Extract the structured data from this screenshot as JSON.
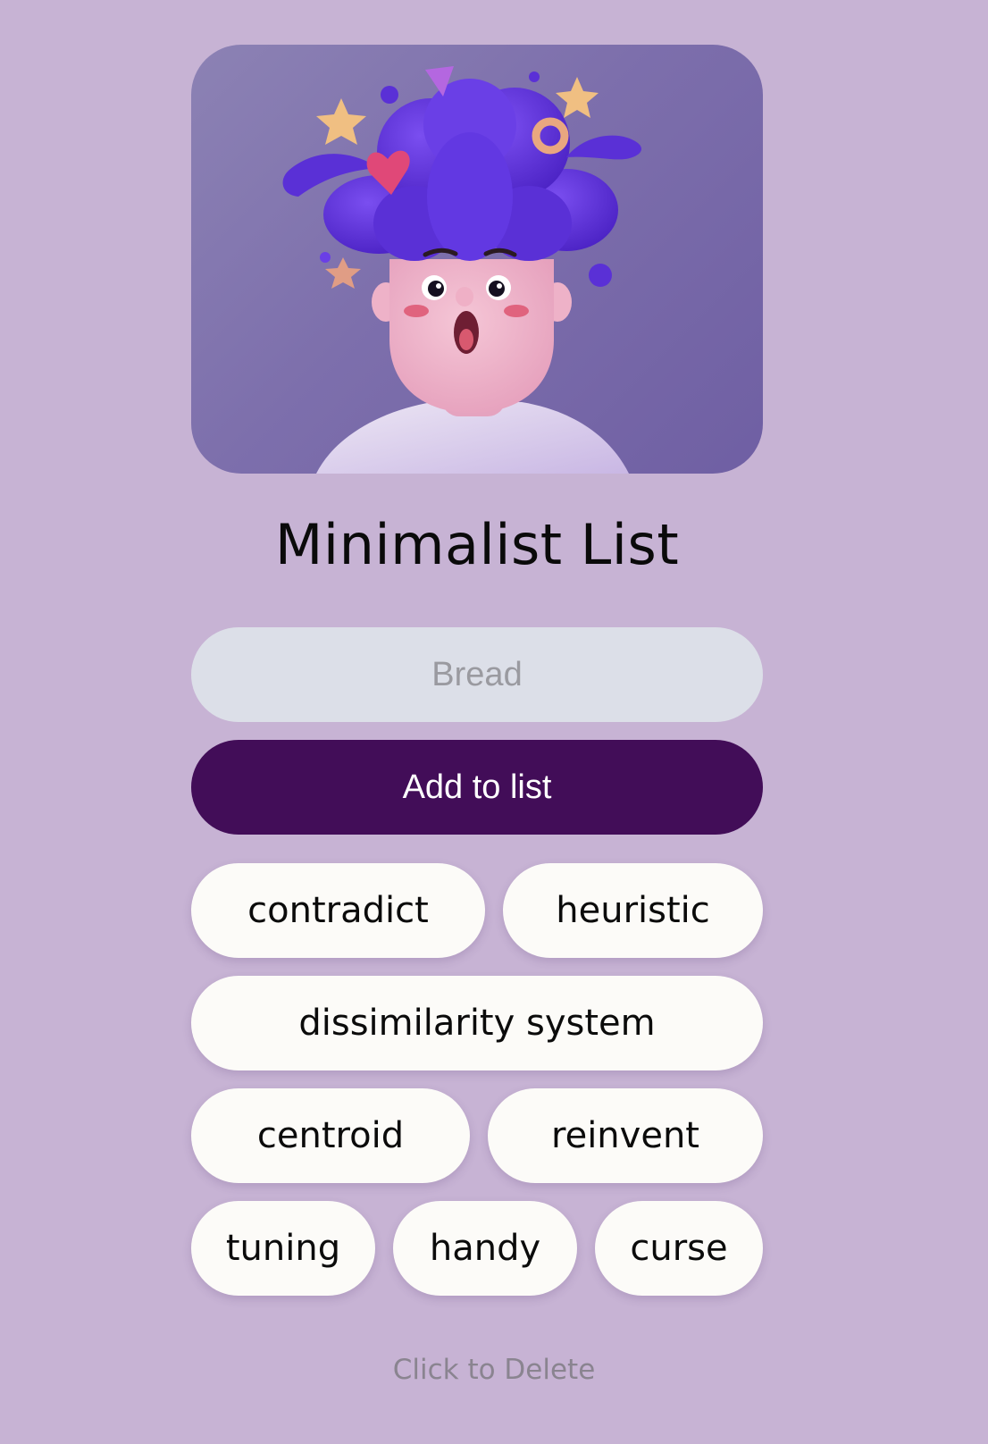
{
  "app": {
    "title": "Minimalist List"
  },
  "input": {
    "placeholder": "Bread",
    "value": ""
  },
  "add_button": {
    "label": "Add to list"
  },
  "items": [
    "contradict",
    "heuristic",
    "dissimilarity system",
    "centroid",
    "reinvent",
    "tuning",
    "handy",
    "curse"
  ],
  "footer": {
    "hint": "Click to Delete"
  },
  "colors": {
    "background": "#c7b3d4",
    "button": "#420d58",
    "input": "#dcdfe8",
    "chip": "#fcfbf8"
  },
  "hero_image": {
    "icon": "surprised-character-illustration"
  }
}
